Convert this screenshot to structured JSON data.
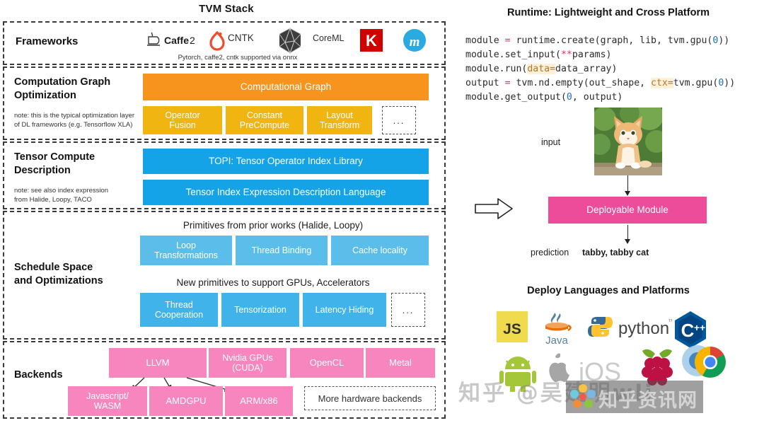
{
  "stack": {
    "title": "TVM Stack",
    "layers": [
      {
        "label": "Frameworks",
        "note": "",
        "caption": "Pytorch, caffe2, cntk supported via onnx",
        "logos": [
          {
            "name": "caffe2-logo",
            "text": "Caffe2"
          },
          {
            "name": "pytorch-logo",
            "text": ""
          },
          {
            "name": "cntk-logo",
            "text": "CNTK"
          },
          {
            "name": "coreml-logo",
            "text": "CoreML"
          },
          {
            "name": "keras-logo",
            "text": "K"
          },
          {
            "name": "mxnet-logo",
            "text": "m"
          }
        ]
      },
      {
        "label": "Computation Graph\nOptimization",
        "label_line1": "Computation Graph",
        "label_line2": "Optimization",
        "note": "note: this is the typical optimization layer of DL frameworks (e.g. Tensorflow XLA)",
        "note_line1": "note: this is the typical optimization layer",
        "note_line2": "of DL frameworks (e.g. Tensorflow XLA)",
        "main_box": "Computational Graph",
        "boxes": [
          "Operator Fusion",
          "Constant PreCompute",
          "Layout Transform"
        ],
        "boxes_split": [
          {
            "l1": "Operator",
            "l2": "Fusion"
          },
          {
            "l1": "Constant",
            "l2": "PreCompute"
          },
          {
            "l1": "Layout",
            "l2": "Transform"
          }
        ],
        "ellipsis": "..."
      },
      {
        "label_line1": "Tensor Compute",
        "label_line2": "Description",
        "note_line1": "note: see also index expression",
        "note_line2": "from Halide, Loopy, TACO",
        "boxes": [
          "TOPI: Tensor Operator Index Library",
          "Tensor Index Expression Description Language"
        ]
      },
      {
        "label_line1": "Schedule Space",
        "label_line2": "and Optimizations",
        "caption1": "Primitives from prior works (Halide, Loopy)",
        "row1": [
          {
            "l1": "Loop",
            "l2": "Transformations"
          },
          {
            "l1": "Thread Binding",
            "l2": ""
          },
          {
            "l1": "Cache locality",
            "l2": ""
          }
        ],
        "caption2": "New primitives to support GPUs, Accelerators",
        "row2": [
          {
            "l1": "Thread",
            "l2": "Cooperation"
          },
          {
            "l1": "Tensorization",
            "l2": ""
          },
          {
            "l1": "Latency Hiding",
            "l2": ""
          }
        ],
        "ellipsis": "..."
      },
      {
        "label": "Backends",
        "row1": [
          {
            "l1": "LLVM",
            "l2": ""
          },
          {
            "l1": "Nvidia GPUs",
            "l2": "(CUDA)"
          },
          {
            "l1": "OpenCL",
            "l2": ""
          },
          {
            "l1": "Metal",
            "l2": ""
          }
        ],
        "row2": [
          {
            "l1": "Javascript/",
            "l2": "WASM"
          },
          {
            "l1": "AMDGPU",
            "l2": ""
          },
          {
            "l1": "ARM/x86",
            "l2": ""
          }
        ],
        "more": "More hardware backends"
      }
    ]
  },
  "runtime": {
    "title": "Runtime: Lightweight and Cross Platform",
    "code_lines": [
      "module = runtime.create(graph, lib, tvm.gpu(0))",
      "module.set_input(**params)",
      "module.run(data=data_array)",
      "output = tvm.nd.empty(out_shape, ctx=tvm.gpu(0))",
      "module.get_output(0, output)"
    ],
    "input_label": "input",
    "module_box": "Deployable Module",
    "prediction_label": "prediction",
    "prediction_value": "tabby, tabby cat"
  },
  "deploy": {
    "title": "Deploy Languages and Platforms",
    "items": [
      {
        "name": "javascript-logo",
        "text": "JS"
      },
      {
        "name": "java-logo",
        "text": "Java"
      },
      {
        "name": "python-logo",
        "text": "python"
      },
      {
        "name": "cplusplus-logo",
        "text": "C++"
      },
      {
        "name": "android-logo",
        "text": ""
      },
      {
        "name": "ios-logo",
        "text": "iOS"
      },
      {
        "name": "raspberry-pi-logo",
        "text": ""
      },
      {
        "name": "chrome-logo",
        "text": ""
      }
    ]
  },
  "watermark": {
    "text1": "知乎 @吴建明wli",
    "text2": "知乎资讯网"
  },
  "colors": {
    "orange": "#F7941E",
    "amber": "#F0B511",
    "blue": "#15A3E8",
    "light_blue": "#5BBEEA",
    "pink": "#F785BE",
    "magenta": "#ED4C9B"
  }
}
